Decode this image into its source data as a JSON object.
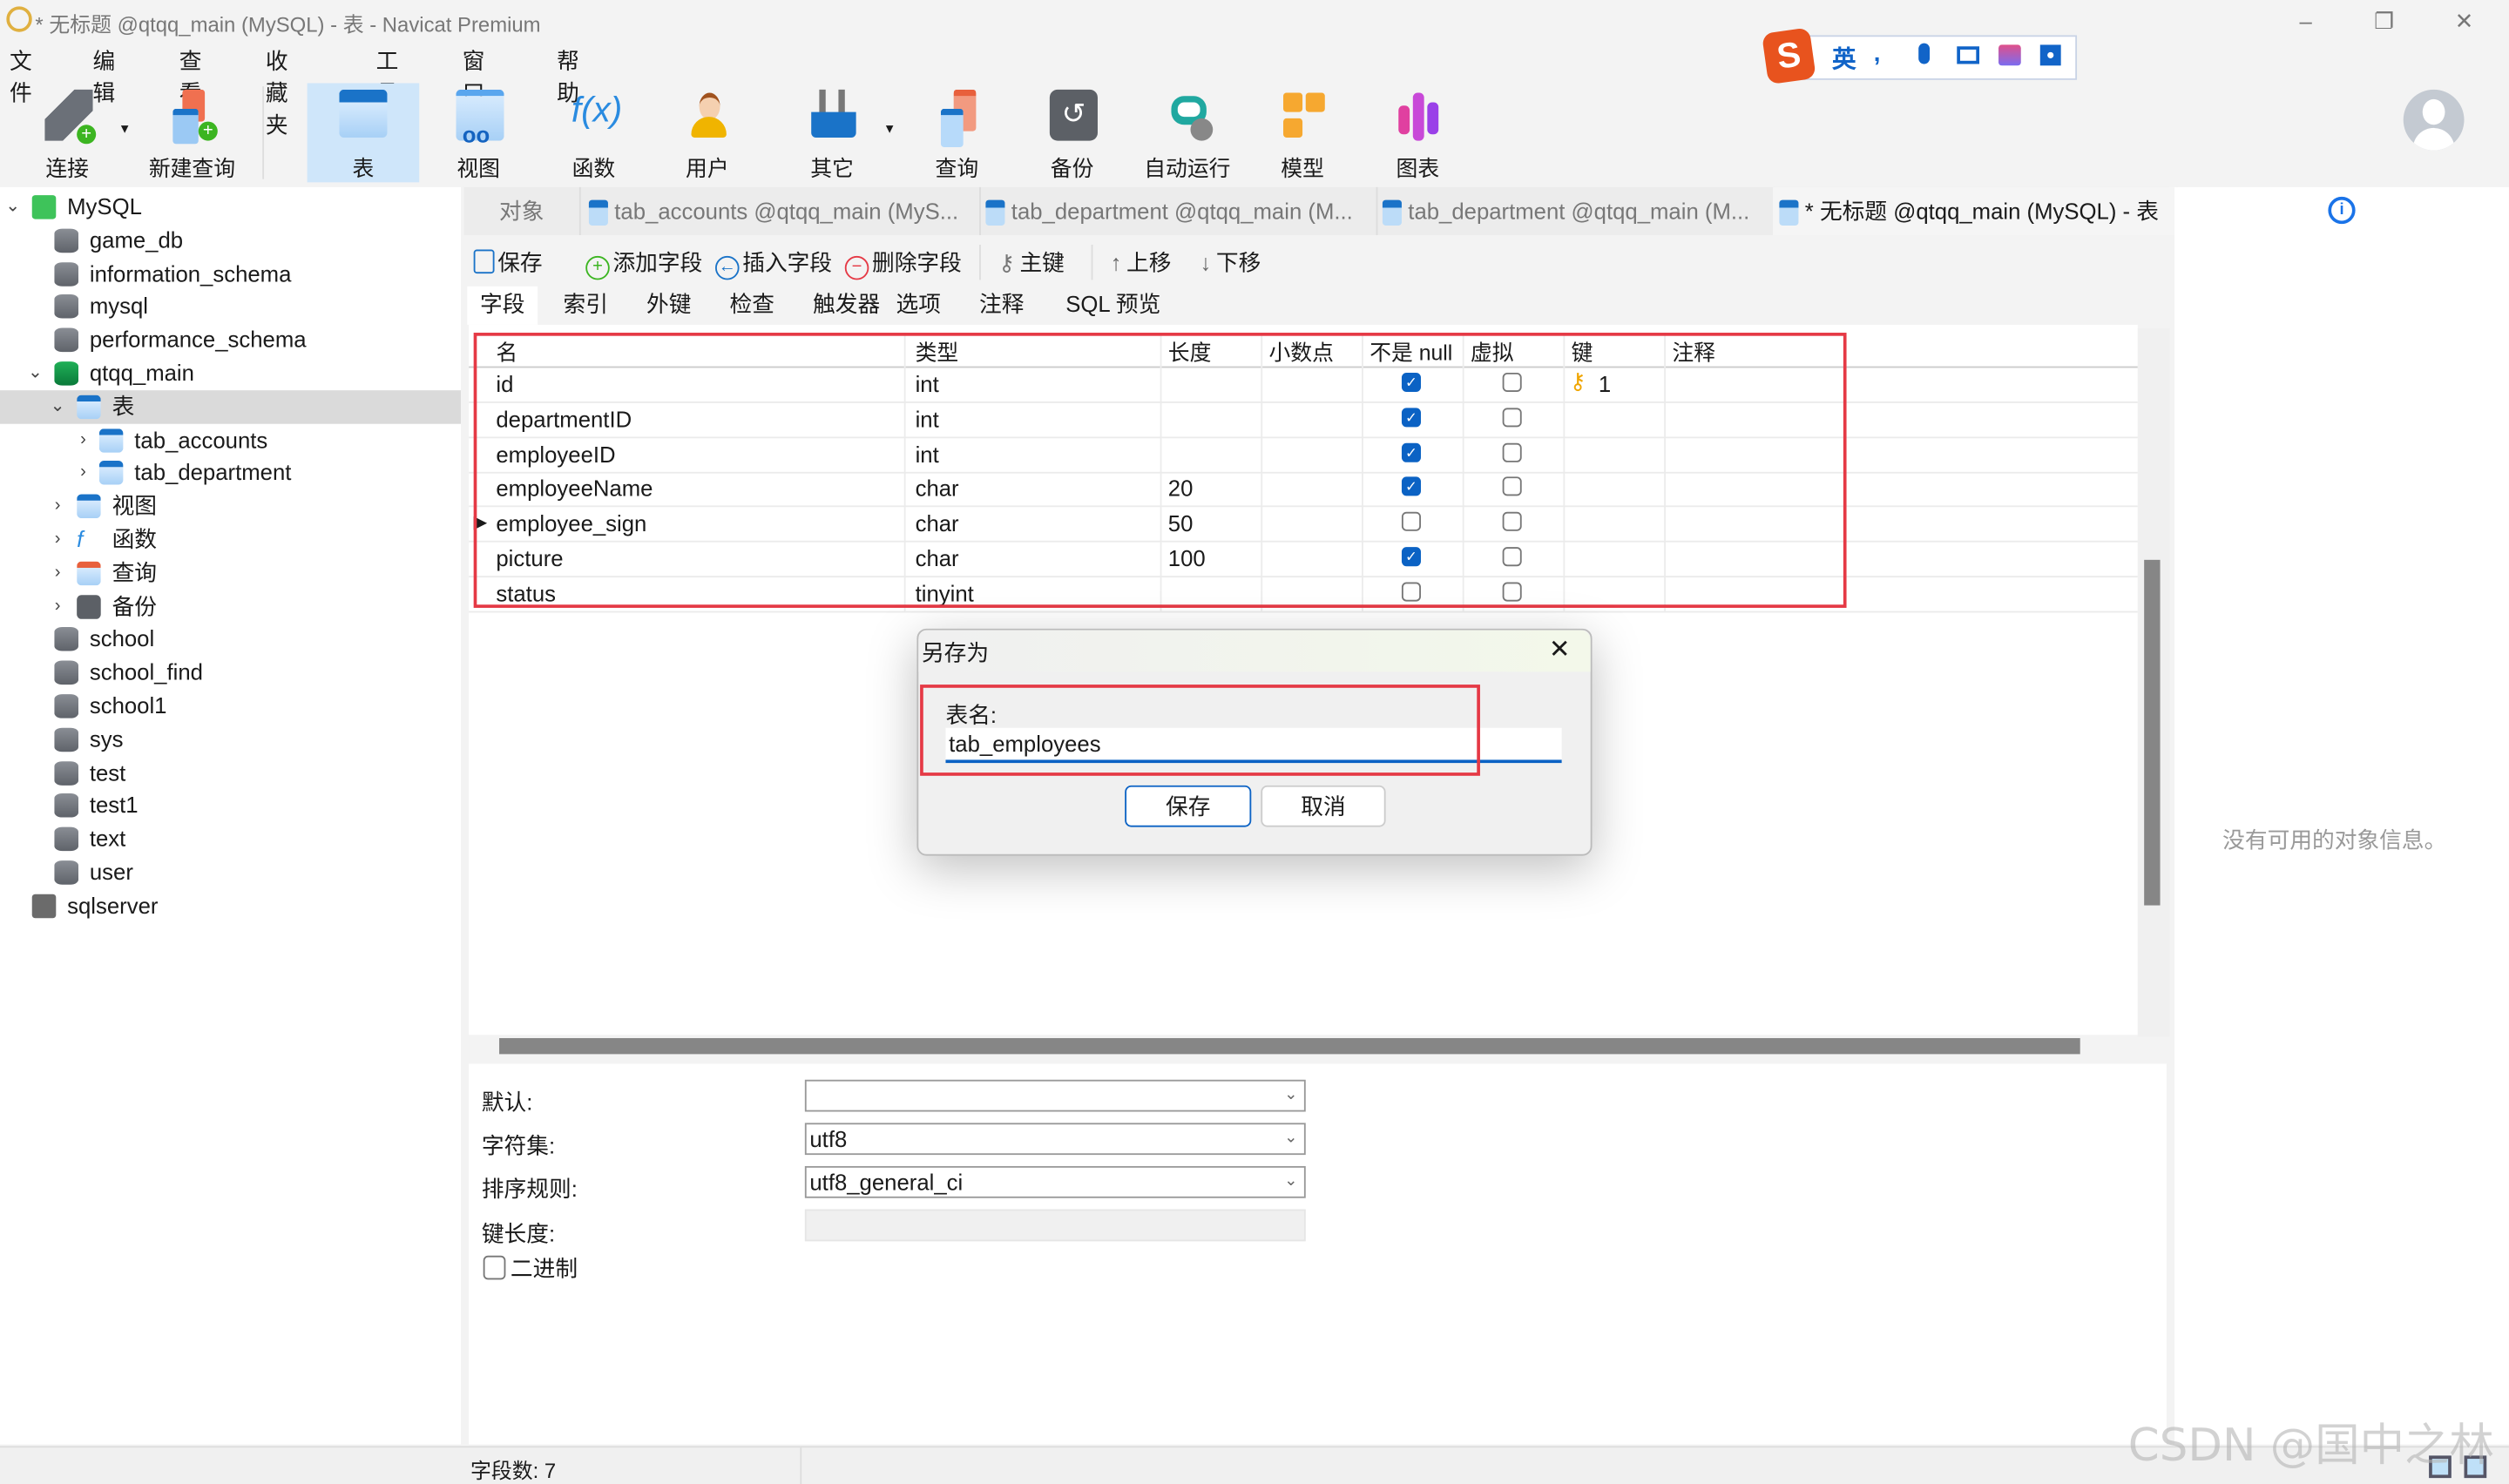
{
  "window": {
    "title": "* 无标题 @qtqq_main (MySQL) - 表 - Navicat Premium",
    "minimize": "–",
    "restore": "❐",
    "close": "✕"
  },
  "menu": [
    "文件",
    "编辑",
    "查看",
    "收藏夹",
    "工具",
    "窗口",
    "帮助"
  ],
  "toolbar": [
    {
      "label": "连接",
      "icon": "plug-icon"
    },
    {
      "label": "新建查询",
      "icon": "new-query-icon"
    },
    {
      "label": "表",
      "icon": "table-icon",
      "active": true
    },
    {
      "label": "视图",
      "icon": "view-icon"
    },
    {
      "label": "函数",
      "icon": "function-icon",
      "glyph": "f(x)"
    },
    {
      "label": "用户",
      "icon": "user-icon"
    },
    {
      "label": "其它",
      "icon": "tools-icon"
    },
    {
      "label": "查询",
      "icon": "query-icon"
    },
    {
      "label": "备份",
      "icon": "backup-icon"
    },
    {
      "label": "自动运行",
      "icon": "robot-icon"
    },
    {
      "label": "模型",
      "icon": "model-icon"
    },
    {
      "label": "图表",
      "icon": "chart-icon"
    }
  ],
  "ime": {
    "lang": "英",
    "punct": "•,"
  },
  "sidebar": {
    "items": [
      {
        "label": "MySQL",
        "level": 0,
        "type": "connection",
        "expanded": true
      },
      {
        "label": "game_db",
        "level": 1,
        "type": "db"
      },
      {
        "label": "information_schema",
        "level": 1,
        "type": "db"
      },
      {
        "label": "mysql",
        "level": 1,
        "type": "db"
      },
      {
        "label": "performance_schema",
        "level": 1,
        "type": "db"
      },
      {
        "label": "qtqq_main",
        "level": 1,
        "type": "db-open",
        "expanded": true
      },
      {
        "label": "表",
        "level": 2,
        "type": "tables",
        "expanded": true,
        "selected": true
      },
      {
        "label": "tab_accounts",
        "level": 3,
        "type": "table"
      },
      {
        "label": "tab_department",
        "level": 3,
        "type": "table"
      },
      {
        "label": "视图",
        "level": 2,
        "type": "views"
      },
      {
        "label": "函数",
        "level": 2,
        "type": "functions"
      },
      {
        "label": "查询",
        "level": 2,
        "type": "queries"
      },
      {
        "label": "备份",
        "level": 2,
        "type": "backups"
      },
      {
        "label": "school",
        "level": 1,
        "type": "db"
      },
      {
        "label": "school_find",
        "level": 1,
        "type": "db"
      },
      {
        "label": "school1",
        "level": 1,
        "type": "db"
      },
      {
        "label": "sys",
        "level": 1,
        "type": "db"
      },
      {
        "label": "test",
        "level": 1,
        "type": "db"
      },
      {
        "label": "test1",
        "level": 1,
        "type": "db"
      },
      {
        "label": "text",
        "level": 1,
        "type": "db"
      },
      {
        "label": "user",
        "level": 1,
        "type": "db"
      },
      {
        "label": "sqlserver",
        "level": 0,
        "type": "sqlserver"
      }
    ]
  },
  "tabs": [
    {
      "label": "对象"
    },
    {
      "label": "tab_accounts @qtqq_main (MyS..."
    },
    {
      "label": "tab_department @qtqq_main (M..."
    },
    {
      "label": "tab_department @qtqq_main (M..."
    },
    {
      "label": "* 无标题 @qtqq_main (MySQL) - 表",
      "active": true
    }
  ],
  "editor_toolbar": {
    "save": "保存",
    "add_field": "添加字段",
    "insert_field": "插入字段",
    "delete_field": "删除字段",
    "primary_key": "主键",
    "move_up": "上移",
    "move_down": "下移"
  },
  "subtabs": [
    "字段",
    "索引",
    "外键",
    "检查",
    "触发器",
    "选项",
    "注释",
    "SQL 预览"
  ],
  "grid": {
    "columns": [
      "名",
      "类型",
      "长度",
      "小数点",
      "不是 null",
      "虚拟",
      "键",
      "注释"
    ],
    "rows": [
      {
        "name": "id",
        "type": "int",
        "length": "",
        "decimals": "",
        "not_null": true,
        "virtual": false,
        "key": "1",
        "comment": ""
      },
      {
        "name": "departmentID",
        "type": "int",
        "length": "",
        "decimals": "",
        "not_null": true,
        "virtual": false,
        "key": "",
        "comment": ""
      },
      {
        "name": "employeeID",
        "type": "int",
        "length": "",
        "decimals": "",
        "not_null": true,
        "virtual": false,
        "key": "",
        "comment": ""
      },
      {
        "name": "employeeName",
        "type": "char",
        "length": "20",
        "decimals": "",
        "not_null": true,
        "virtual": false,
        "key": "",
        "comment": ""
      },
      {
        "name": "employee_sign",
        "type": "char",
        "length": "50",
        "decimals": "",
        "not_null": false,
        "virtual": false,
        "key": "",
        "comment": "",
        "current": true
      },
      {
        "name": "picture",
        "type": "char",
        "length": "100",
        "decimals": "",
        "not_null": true,
        "virtual": false,
        "key": "",
        "comment": ""
      },
      {
        "name": "status",
        "type": "tinyint",
        "length": "",
        "decimals": "",
        "not_null": false,
        "virtual": false,
        "key": "",
        "comment": ""
      }
    ]
  },
  "props": {
    "default_label": "默认:",
    "default_value": "",
    "charset_label": "字符集:",
    "charset_value": "utf8",
    "collation_label": "排序规则:",
    "collation_value": "utf8_general_ci",
    "keylen_label": "键长度:",
    "keylen_value": "",
    "binary_label": "二进制",
    "binary_checked": false
  },
  "right_panel": {
    "empty_text": "没有可用的对象信息。"
  },
  "dialog": {
    "title": "另存为",
    "field_label": "表名:",
    "field_value": "tab_employees",
    "save": "保存",
    "cancel": "取消"
  },
  "status": {
    "field_count": "字段数: 7"
  },
  "watermark": "CSDN @国中之林",
  "colors": {
    "accent": "#0b62c4",
    "highlight_box": "#e53945",
    "key_icon": "#f0a500"
  }
}
